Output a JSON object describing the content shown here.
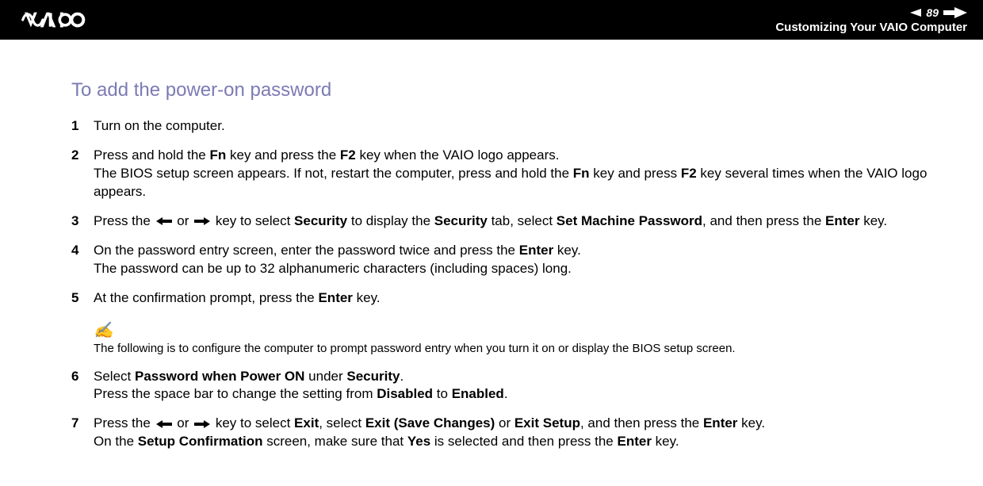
{
  "header": {
    "page_number": "89",
    "section": "Customizing Your VAIO Computer"
  },
  "page": {
    "heading": "To add the power-on password",
    "steps": [
      {
        "num": "1",
        "html": "Turn on the computer."
      },
      {
        "num": "2",
        "html": "Press and hold the <b>Fn</b> key and press the <b>F2</b> key when the VAIO logo appears.<br>The BIOS setup screen appears. If not, restart the computer, press and hold the <b>Fn</b> key and press <b>F2</b> key several times when the VAIO logo appears."
      },
      {
        "num": "3",
        "html": "Press the {LEFT} or {RIGHT} key to select <b>Security</b> to display the <b>Security</b> tab, select <b>Set Machine Password</b>, and then press the <b>Enter</b> key."
      },
      {
        "num": "4",
        "html": "On the password entry screen, enter the password twice and press the <b>Enter</b> key.<br>The password can be up to 32 alphanumeric characters (including spaces) long."
      },
      {
        "num": "5",
        "html": "At the confirmation prompt, press the <b>Enter</b> key."
      }
    ],
    "note": {
      "icon": "✍",
      "text": "The following is to configure the computer to prompt password entry when you turn it on or display the BIOS setup screen."
    },
    "steps2": [
      {
        "num": "6",
        "html": "Select <b>Password when Power ON</b> under <b>Security</b>.<br>Press the space bar to change the setting from <b>Disabled</b> to <b>Enabled</b>."
      },
      {
        "num": "7",
        "html": "Press the {LEFT} or {RIGHT} key to select <b>Exit</b>, select <b>Exit (Save Changes)</b> or <b>Exit Setup</b>, and then press the <b>Enter</b> key.<br>On the <b>Setup Confirmation</b> screen, make sure that <b>Yes</b> is selected and then press the <b>Enter</b> key."
      }
    ]
  }
}
